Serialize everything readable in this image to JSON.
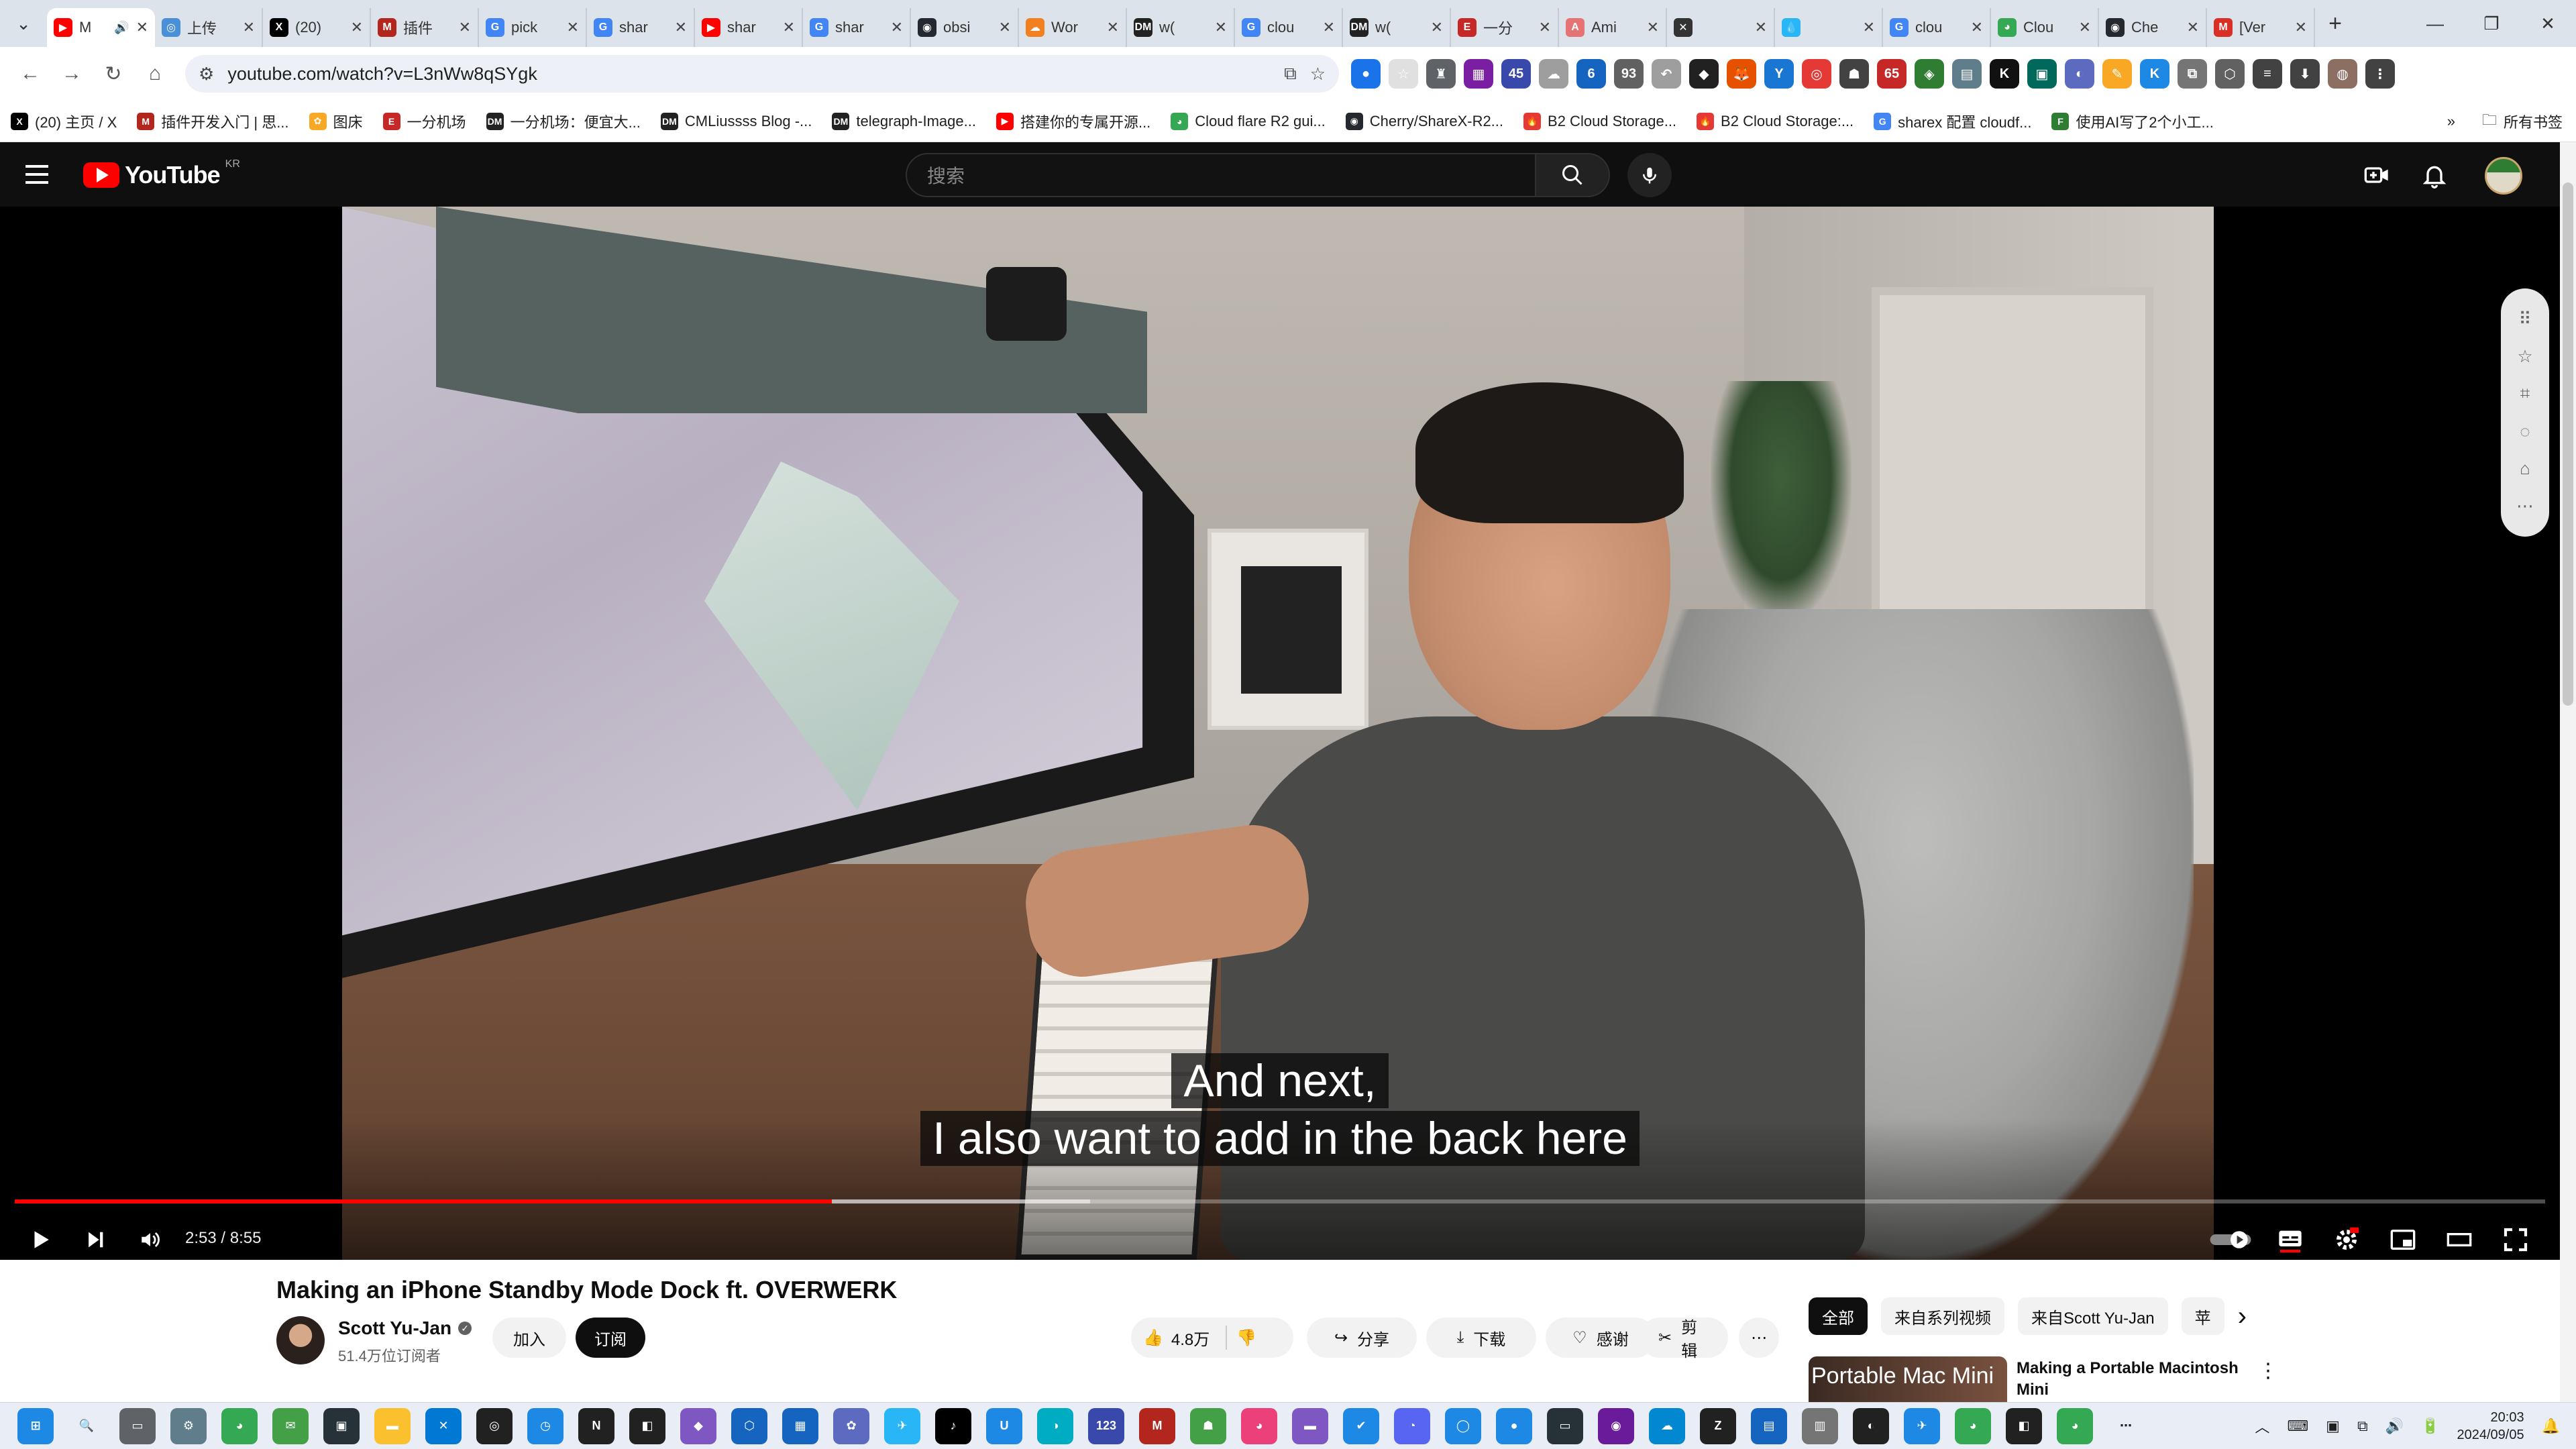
{
  "browser": {
    "tabs": [
      {
        "title": "M",
        "color": "#ff0000",
        "glyph": "▶",
        "active": true,
        "muted_icon": "🔊"
      },
      {
        "title": "上传",
        "color": "#4a90d9",
        "glyph": "◎"
      },
      {
        "title": "(20)",
        "color": "#000000",
        "glyph": "X"
      },
      {
        "title": "插件",
        "color": "#b3261e",
        "glyph": "M"
      },
      {
        "title": "pick",
        "color": "#4285f4",
        "glyph": "G"
      },
      {
        "title": "shar",
        "color": "#4285f4",
        "glyph": "G"
      },
      {
        "title": "shar",
        "color": "#ff0000",
        "glyph": "▶"
      },
      {
        "title": "shar",
        "color": "#4285f4",
        "glyph": "G"
      },
      {
        "title": "obsi",
        "color": "#24292f",
        "glyph": "◉"
      },
      {
        "title": "Wor",
        "color": "#f38020",
        "glyph": "☁"
      },
      {
        "title": "w(",
        "color": "#222222",
        "glyph": "DM"
      },
      {
        "title": "clou",
        "color": "#4285f4",
        "glyph": "G"
      },
      {
        "title": "w(",
        "color": "#222222",
        "glyph": "DM"
      },
      {
        "title": "一分",
        "color": "#c62828",
        "glyph": "E"
      },
      {
        "title": "Ami",
        "color": "#e57373",
        "glyph": "A"
      },
      {
        "title": "",
        "color": "#333333",
        "glyph": "✕"
      },
      {
        "title": "",
        "color": "#29b6f6",
        "glyph": "💧"
      },
      {
        "title": "clou",
        "color": "#4285f4",
        "glyph": "G"
      },
      {
        "title": "Clou",
        "color": "#34a853",
        "glyph": "◕"
      },
      {
        "title": "Che",
        "color": "#24292f",
        "glyph": "◉"
      },
      {
        "title": "[Ver",
        "color": "#d93025",
        "glyph": "M"
      }
    ],
    "tab_close": "✕",
    "new_tab": "+",
    "window": {
      "minimize": "—",
      "restore": "❐",
      "close": "✕"
    },
    "nav": {
      "back": "←",
      "forward": "→",
      "reload": "↻",
      "home": "⌂"
    },
    "url": "youtube.com/watch?v=L3nWw8qSYgk",
    "omnibox_icons": {
      "site_info": "⚙",
      "cast": "⧉",
      "bookmark": "☆"
    },
    "extensions": [
      {
        "color": "#1a73e8",
        "glyph": "●"
      },
      {
        "color": "#e0e0e0",
        "glyph": "☆"
      },
      {
        "color": "#5f6368",
        "glyph": "♜"
      },
      {
        "color": "#7b1fa2",
        "glyph": "▦"
      },
      {
        "color": "#3949ab",
        "glyph": "45"
      },
      {
        "color": "#9e9e9e",
        "glyph": "☁"
      },
      {
        "color": "#1565c0",
        "glyph": "6"
      },
      {
        "color": "#616161",
        "glyph": "93"
      },
      {
        "color": "#9e9e9e",
        "glyph": "↶"
      },
      {
        "color": "#212121",
        "glyph": "◆"
      },
      {
        "color": "#e65100",
        "glyph": "🦊"
      },
      {
        "color": "#1976d2",
        "glyph": "Y"
      },
      {
        "color": "#e53935",
        "glyph": "◎"
      },
      {
        "color": "#424242",
        "glyph": "☗"
      },
      {
        "color": "#c62828",
        "glyph": "65"
      },
      {
        "color": "#2e7d32",
        "glyph": "◈"
      },
      {
        "color": "#607d8b",
        "glyph": "▤"
      },
      {
        "color": "#111111",
        "glyph": "K"
      },
      {
        "color": "#00695c",
        "glyph": "▣"
      },
      {
        "color": "#5c6bc0",
        "glyph": "◐"
      },
      {
        "color": "#f9a825",
        "glyph": "✎"
      },
      {
        "color": "#1e88e5",
        "glyph": "K"
      },
      {
        "color": "#757575",
        "glyph": "⧉"
      },
      {
        "color": "#616161",
        "glyph": "⬡"
      },
      {
        "color": "#424242",
        "glyph": "≡"
      },
      {
        "color": "#424242",
        "glyph": "⬇"
      },
      {
        "color": "#8d6e63",
        "glyph": "◍"
      },
      {
        "color": "#424242",
        "glyph": "⋮"
      }
    ],
    "bookmarks": [
      {
        "label": "(20) 主页 / X",
        "color": "#000000",
        "glyph": "X"
      },
      {
        "label": "插件开发入门 | 思...",
        "color": "#b3261e",
        "glyph": "M"
      },
      {
        "label": "图床",
        "color": "#f9a825",
        "glyph": "✿"
      },
      {
        "label": "一分机场",
        "color": "#c62828",
        "glyph": "E"
      },
      {
        "label": "一分机场：便宜大...",
        "color": "#222222",
        "glyph": "DM"
      },
      {
        "label": "CMLiussss Blog -...",
        "color": "#222222",
        "glyph": "DM"
      },
      {
        "label": "telegraph-Image...",
        "color": "#222222",
        "glyph": "DM"
      },
      {
        "label": "搭建你的专属开源...",
        "color": "#ff0000",
        "glyph": "▶"
      },
      {
        "label": "Cloud flare R2 gui...",
        "color": "#34a853",
        "glyph": "◕"
      },
      {
        "label": "Cherry/ShareX-R2...",
        "color": "#24292f",
        "glyph": "◉"
      },
      {
        "label": "B2 Cloud Storage...",
        "color": "#e53935",
        "glyph": "🔥"
      },
      {
        "label": "B2 Cloud Storage:...",
        "color": "#e53935",
        "glyph": "🔥"
      },
      {
        "label": "sharex 配置 cloudf...",
        "color": "#4285f4",
        "glyph": "G"
      },
      {
        "label": "使用AI写了2个小工...",
        "color": "#2e7d32",
        "glyph": "F"
      }
    ],
    "bookmarks_overflow": "»",
    "all_bookmarks": "所有书签"
  },
  "youtube": {
    "logo_text": "YouTube",
    "country": "KR",
    "search_placeholder": "搜索",
    "video": {
      "caption_lines": [
        "And next,",
        "I also want to add in the back here"
      ],
      "current_time": "2:53",
      "duration": "8:55",
      "progress": 0.323,
      "buffered": 0.425
    },
    "title": "Making an iPhone Standby Mode Dock ft. OVERWERK",
    "channel": {
      "name": "Scott Yu-Jan",
      "subscribers": "51.4万位订阅者"
    },
    "join_label": "加入",
    "subscribe_label": "订阅",
    "likes": "4.8万",
    "share_label": "分享",
    "download_label": "下载",
    "thanks_label": "感谢",
    "clip_label": "剪辑",
    "more_label": "⋯",
    "chips": [
      "全部",
      "来自系列视频",
      "来自Scott Yu-Jan",
      "苹"
    ],
    "chips_next": "›",
    "recommendation": {
      "thumb_text": "Portable Mac Mini",
      "title": "Making a Portable Macintosh Mini",
      "more": "⋮"
    }
  },
  "side_tools": [
    "⠿",
    "☆",
    "⌗",
    "◌",
    "⌂",
    "⋯"
  ],
  "taskbar": {
    "apps": [
      {
        "color": "#1e88e5",
        "glyph": "⊞"
      },
      {
        "color": "#e9eef6",
        "glyph": "🔍"
      },
      {
        "color": "#5f6368",
        "glyph": "▭"
      },
      {
        "color": "#607d8b",
        "glyph": "⚙"
      },
      {
        "color": "#34a853",
        "glyph": "◕"
      },
      {
        "color": "#43a047",
        "glyph": "✉"
      },
      {
        "color": "#263238",
        "glyph": "▣"
      },
      {
        "color": "#fbc02d",
        "glyph": "▬"
      },
      {
        "color": "#0078d4",
        "glyph": "✕"
      },
      {
        "color": "#212121",
        "glyph": "◎"
      },
      {
        "color": "#1e88e5",
        "glyph": "◷"
      },
      {
        "color": "#212121",
        "glyph": "N"
      },
      {
        "color": "#212121",
        "glyph": "◧"
      },
      {
        "color": "#7e57c2",
        "glyph": "◆"
      },
      {
        "color": "#1565c0",
        "glyph": "⬡"
      },
      {
        "color": "#1565c0",
        "glyph": "▦"
      },
      {
        "color": "#5c6bc0",
        "glyph": "✿"
      },
      {
        "color": "#29b6f6",
        "glyph": "✈"
      },
      {
        "color": "#000000",
        "glyph": "♪"
      },
      {
        "color": "#1e88e5",
        "glyph": "U"
      },
      {
        "color": "#00acc1",
        "glyph": "◑"
      },
      {
        "color": "#3949ab",
        "glyph": "123"
      },
      {
        "color": "#b3261e",
        "glyph": "M"
      },
      {
        "color": "#43a047",
        "glyph": "☗"
      },
      {
        "color": "#ec407a",
        "glyph": "◕"
      },
      {
        "color": "#7e57c2",
        "glyph": "▬"
      },
      {
        "color": "#1e88e5",
        "glyph": "✔"
      },
      {
        "color": "#5865f2",
        "glyph": "◔"
      },
      {
        "color": "#1e88e5",
        "glyph": "◯"
      },
      {
        "color": "#1e88e5",
        "glyph": "●"
      },
      {
        "color": "#263238",
        "glyph": "▭"
      },
      {
        "color": "#6a1b9a",
        "glyph": "◉"
      },
      {
        "color": "#0288d1",
        "glyph": "☁"
      },
      {
        "color": "#212121",
        "glyph": "Z"
      },
      {
        "color": "#1565c0",
        "glyph": "▤"
      },
      {
        "color": "#757575",
        "glyph": "▥"
      },
      {
        "color": "#212121",
        "glyph": "◐"
      },
      {
        "color": "#1e88e5",
        "glyph": "✈"
      },
      {
        "color": "#34a853",
        "glyph": "◕"
      },
      {
        "color": "#212121",
        "glyph": "◧"
      },
      {
        "color": "#34a853",
        "glyph": "◕"
      },
      {
        "color": "#e9eef6",
        "glyph": "⋯"
      }
    ],
    "tray_icons": [
      "︿",
      "⌨",
      "▣",
      "⧉",
      "🔊",
      "🔋"
    ],
    "time": "20:03",
    "date": "2024/09/05",
    "notification": "🔔"
  }
}
